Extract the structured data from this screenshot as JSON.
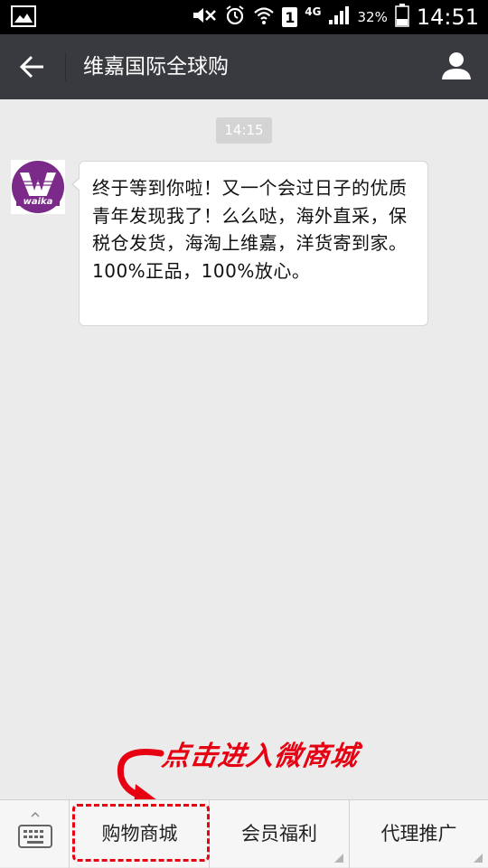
{
  "status_bar": {
    "battery_percent": "32%",
    "network": "4G",
    "sim_slot": "1",
    "time": "14:51"
  },
  "app_bar": {
    "title": "维嘉国际全球购"
  },
  "chat": {
    "timestamp": "14:15",
    "messages": [
      {
        "sender_logo_text": "waika",
        "text": "终于等到你啦！又一个会过日子的优质青年发现我了！么么哒，海外直采，保税仓发货，海淘上维嘉，洋货寄到家。100%正品，100%放心。"
      }
    ]
  },
  "annotation": {
    "text": "点击进入微商城",
    "color": "#e60012"
  },
  "bottom_menu": {
    "items": [
      {
        "label": "购物商城"
      },
      {
        "label": "会员福利"
      },
      {
        "label": "代理推广"
      }
    ]
  },
  "colors": {
    "app_bar": "#393a3f",
    "background": "#ebebeb",
    "logo_purple": "#7b2a8a"
  }
}
